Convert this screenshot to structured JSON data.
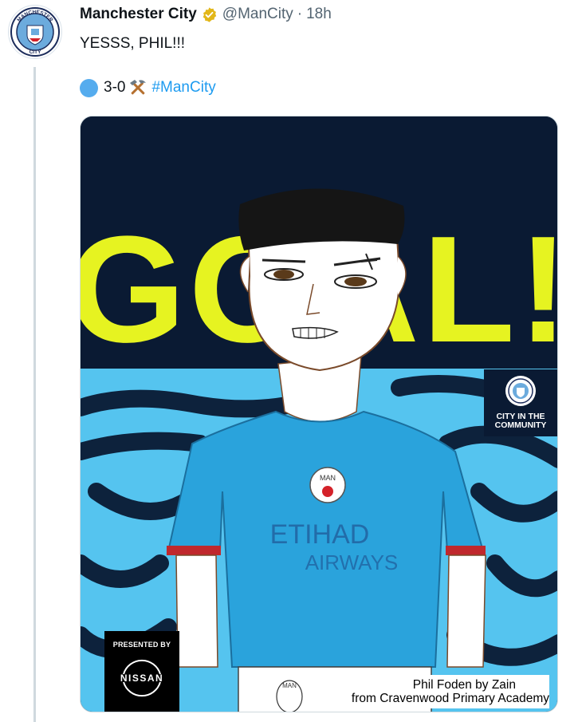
{
  "tweet": {
    "author_name": "Manchester City",
    "handle": "@ManCity",
    "separator": "·",
    "time": "18h",
    "text_line1": "YESSS, PHIL!!!",
    "score": "3-0",
    "hashtag": "#ManCity"
  },
  "avatar": {
    "badge_text_top": "MANCHESTER",
    "badge_text_bottom": "CITY"
  },
  "media": {
    "headline": "GOAL!",
    "shirt_text_line1": "ETIHAD",
    "shirt_text_line2": "AIRWAYS",
    "crest_text": "MAN",
    "short_crest_text": "MAN",
    "cic_label": "CITY IN THE COMMUNITY",
    "presented_by": "PRESENTED BY",
    "sponsor": "NISSAN",
    "caption_line1": "Phil Foden by Zain",
    "caption_line2": "from Cravenwood Primary Academy"
  },
  "colors": {
    "navy": "#0a1a33",
    "sky_blue": "#55c4ef",
    "neon_yellow": "#e6f321",
    "shirt_blue": "#2aa3dc",
    "link_blue": "#1d9bf0",
    "verified_gold": "#e2b719"
  },
  "icons": [
    "verified-badge-icon",
    "blue-circle-emoji",
    "hammer-pick-emoji"
  ]
}
